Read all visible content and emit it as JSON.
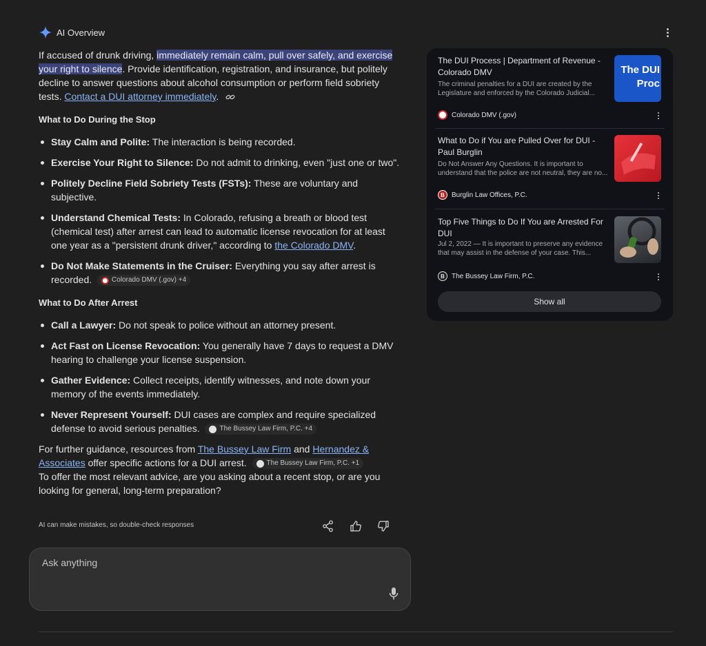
{
  "header": {
    "title": "AI Overview",
    "icon": "sparkle-icon",
    "accent": "#8ab4f8"
  },
  "intro": {
    "before": "If accused of drunk driving, ",
    "highlight": "immediately remain calm, pull over safely, and exercise your right to silence",
    "after": ". Provide identification, registration, and insurance, but politely decline to answer questions about alcohol consumption or perform field sobriety tests. ",
    "link": "Contact a DUI attorney immediately",
    "end": "."
  },
  "during": {
    "heading": "What to Do During the Stop",
    "items": [
      {
        "bold": "Stay Calm and Polite:",
        "text": " The interaction is being recorded."
      },
      {
        "bold": "Exercise Your Right to Silence:",
        "text": " Do not admit to drinking, even \"just one or two\"."
      },
      {
        "bold": "Politely Decline Field Sobriety Tests (FSTs):",
        "text": " These are voluntary and subjective."
      },
      {
        "bold": "Understand Chemical Tests:",
        "text": " In Colorado, refusing a breath or blood test (chemical test) after arrest can lead to automatic license revocation for at least one year as a \"persistent drunk driver,\" according to ",
        "link": "the Colorado DMV",
        "end": "."
      },
      {
        "bold": "Do Not Make Statements in the Cruiser:",
        "text": " Everything you say after arrest is recorded.",
        "chip": "Colorado DMV (.gov) +4"
      }
    ]
  },
  "after": {
    "heading": "What to Do After Arrest",
    "items": [
      {
        "bold": "Call a Lawyer:",
        "text": " Do not speak to police without an attorney present."
      },
      {
        "bold": "Act Fast on License Revocation:",
        "text": " You generally have 7 days to request a DMV hearing to challenge your license suspension."
      },
      {
        "bold": "Gather Evidence:",
        "text": " Collect receipts, identify witnesses, and note down your memory of the events immediately."
      },
      {
        "bold": "Never Represent Yourself:",
        "text": " DUI cases are complex and require specialized defense to avoid serious penalties.",
        "chip": "The Bussey Law Firm, P.C. +4"
      }
    ]
  },
  "guidance": {
    "before": "For further guidance, resources from ",
    "link1": "The Bussey Law Firm",
    "mid": " and ",
    "link2": "Hernandez & Associates",
    "after": " offer specific actions for a DUI arrest.",
    "chip": "The Bussey Law Firm, P.C. +1"
  },
  "question": "To offer the most relevant advice, are you asking about a recent stop, or are you looking for general, long-term preparation?",
  "disclaimer": "AI can make mistakes, so double-check responses",
  "ask": {
    "placeholder": "Ask anything"
  },
  "sources": [
    {
      "title": "The DUI Process | Department of Revenue - Colorado DMV",
      "snippet": "The criminal penalties for a DUI are created by the Legislature and enforced by the Colorado Judicial...",
      "source": "Colorado DMV (.gov)",
      "thumb_text": "The DUI Proc",
      "thumb_bg": "#1a56c8"
    },
    {
      "title": "What to Do if You are Pulled Over for DUI - Paul Burglin",
      "snippet": "Do Not Answer Any Questions. It is important to understand that the police are not neutral, they are no...",
      "source": "Burglin Law Offices, P.C.",
      "thumb_bg": "#d8262e"
    },
    {
      "title": "Top Five Things to Do If You are Arrested For DUI",
      "snippet": "Jul 2, 2022 — It is important to preserve any evidence that may assist in the defense of your case. This...",
      "source": "The Bussey Law Firm, P.C.",
      "thumb_bg": "#3a3d42"
    }
  ],
  "show_all": "Show all"
}
